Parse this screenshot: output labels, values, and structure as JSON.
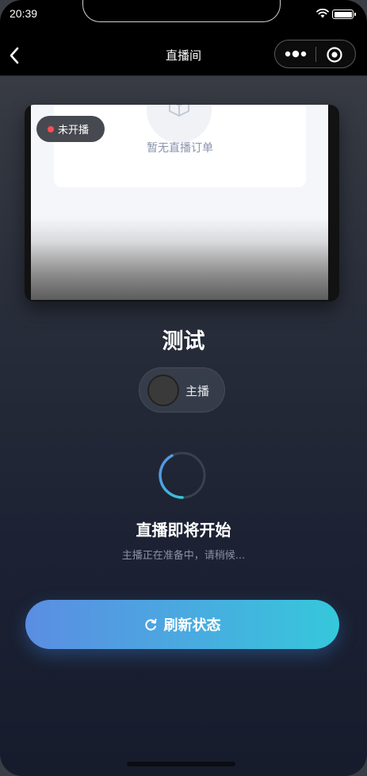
{
  "status_bar": {
    "time": "20:39"
  },
  "nav": {
    "title": "直播间"
  },
  "preview": {
    "badge_text": "未开播",
    "empty_text": "暂无直播订单"
  },
  "room": {
    "title": "测试",
    "host_role": "主播"
  },
  "status": {
    "title": "直播即将开始",
    "subtitle": "主播正在准备中，请稍候..."
  },
  "actions": {
    "refresh_label": "刷新状态"
  },
  "colors": {
    "accent_start": "#5b8de2",
    "accent_end": "#35c8db",
    "badge_dot": "#ff4d4f"
  },
  "icons": {
    "back": "back-icon",
    "more": "more-icon",
    "close": "close-icon",
    "wifi": "wifi-icon",
    "battery": "battery-icon",
    "box": "box-icon",
    "spinner": "spinner-icon",
    "refresh": "refresh-icon"
  }
}
